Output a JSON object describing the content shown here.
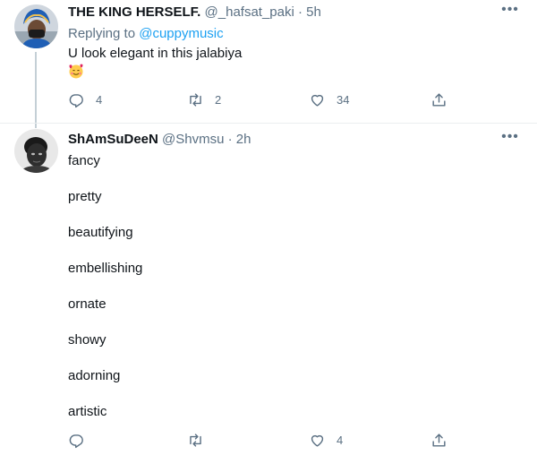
{
  "tweets": [
    {
      "display_name": "THE KING HERSELF.",
      "handle": "@_hafsat_paki",
      "separator": "·",
      "time": "5h",
      "replying_prefix": "Replying to",
      "replying_to": "@cuppymusic",
      "text_lines": [
        "U look elegant in this jalabiya"
      ],
      "emoji": "smiling-face-with-hearts",
      "replies": "4",
      "retweets": "2",
      "likes": "34"
    },
    {
      "display_name": "ShAmSuDeeN",
      "handle": "@Shvmsu",
      "separator": "·",
      "time": "2h",
      "text_lines": [
        "fancy",
        "pretty",
        "beautifying",
        "embellishing",
        "ornate",
        "showy",
        "adorning",
        "artistic"
      ],
      "replies": "",
      "retweets": "",
      "likes": "4"
    }
  ],
  "icons": {
    "more": "more-horizontal-icon",
    "reply": "reply-icon",
    "retweet": "retweet-icon",
    "like": "like-heart-icon",
    "share": "share-icon"
  },
  "colors": {
    "accent": "#1da1f2",
    "secondary_text": "#5b7083",
    "primary_text": "#0f1419",
    "divider": "#ebeef0"
  }
}
